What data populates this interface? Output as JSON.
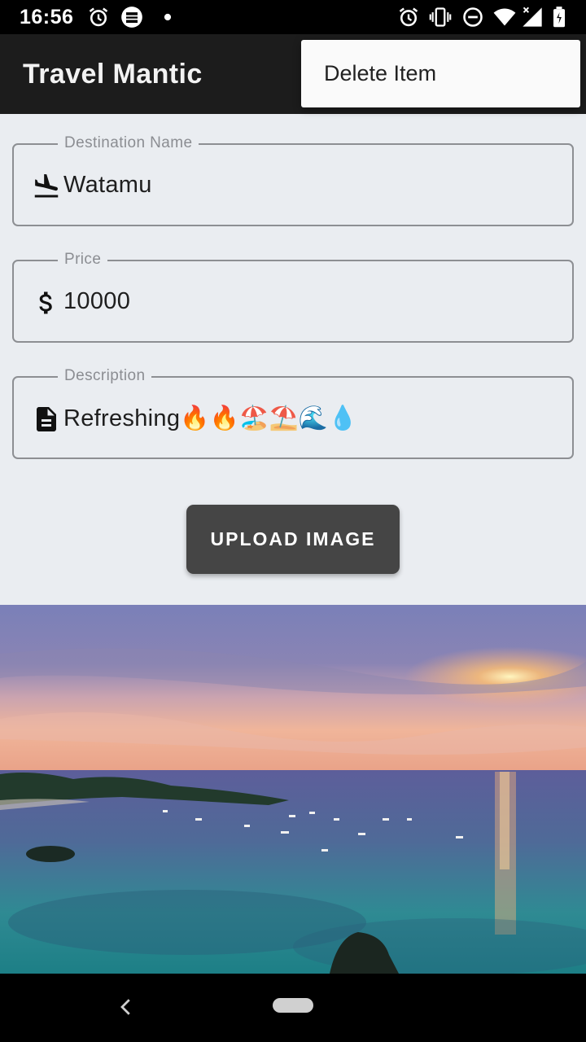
{
  "status_bar": {
    "time": "16:56",
    "left_icons": [
      "alarm-icon",
      "anybooks-notification-icon",
      "dot-icon"
    ],
    "right_icons": [
      "alarm-icon",
      "vibrate-icon",
      "do-not-disturb-icon",
      "wifi-icon",
      "signal-icon",
      "battery-icon"
    ]
  },
  "app_bar": {
    "title": "Travel Mantic"
  },
  "popup_menu": {
    "items": [
      {
        "label": "Delete Item"
      }
    ]
  },
  "form": {
    "destination": {
      "label": "Destination Name",
      "value": "Watamu",
      "icon": "flight-land-icon"
    },
    "price": {
      "label": "Price",
      "value": "10000",
      "icon": "dollar-icon"
    },
    "description": {
      "label": "Description",
      "value": "Refreshing🔥🔥🏖️⛱️🌊💧",
      "icon": "description-icon"
    },
    "upload_label": "UPLOAD IMAGE"
  },
  "image": {
    "subject": "sunset-over-sea-with-boats"
  },
  "colors": {
    "app_bar": "#1c1c1c",
    "content_bg": "#eaedf1",
    "button": "#454545"
  }
}
